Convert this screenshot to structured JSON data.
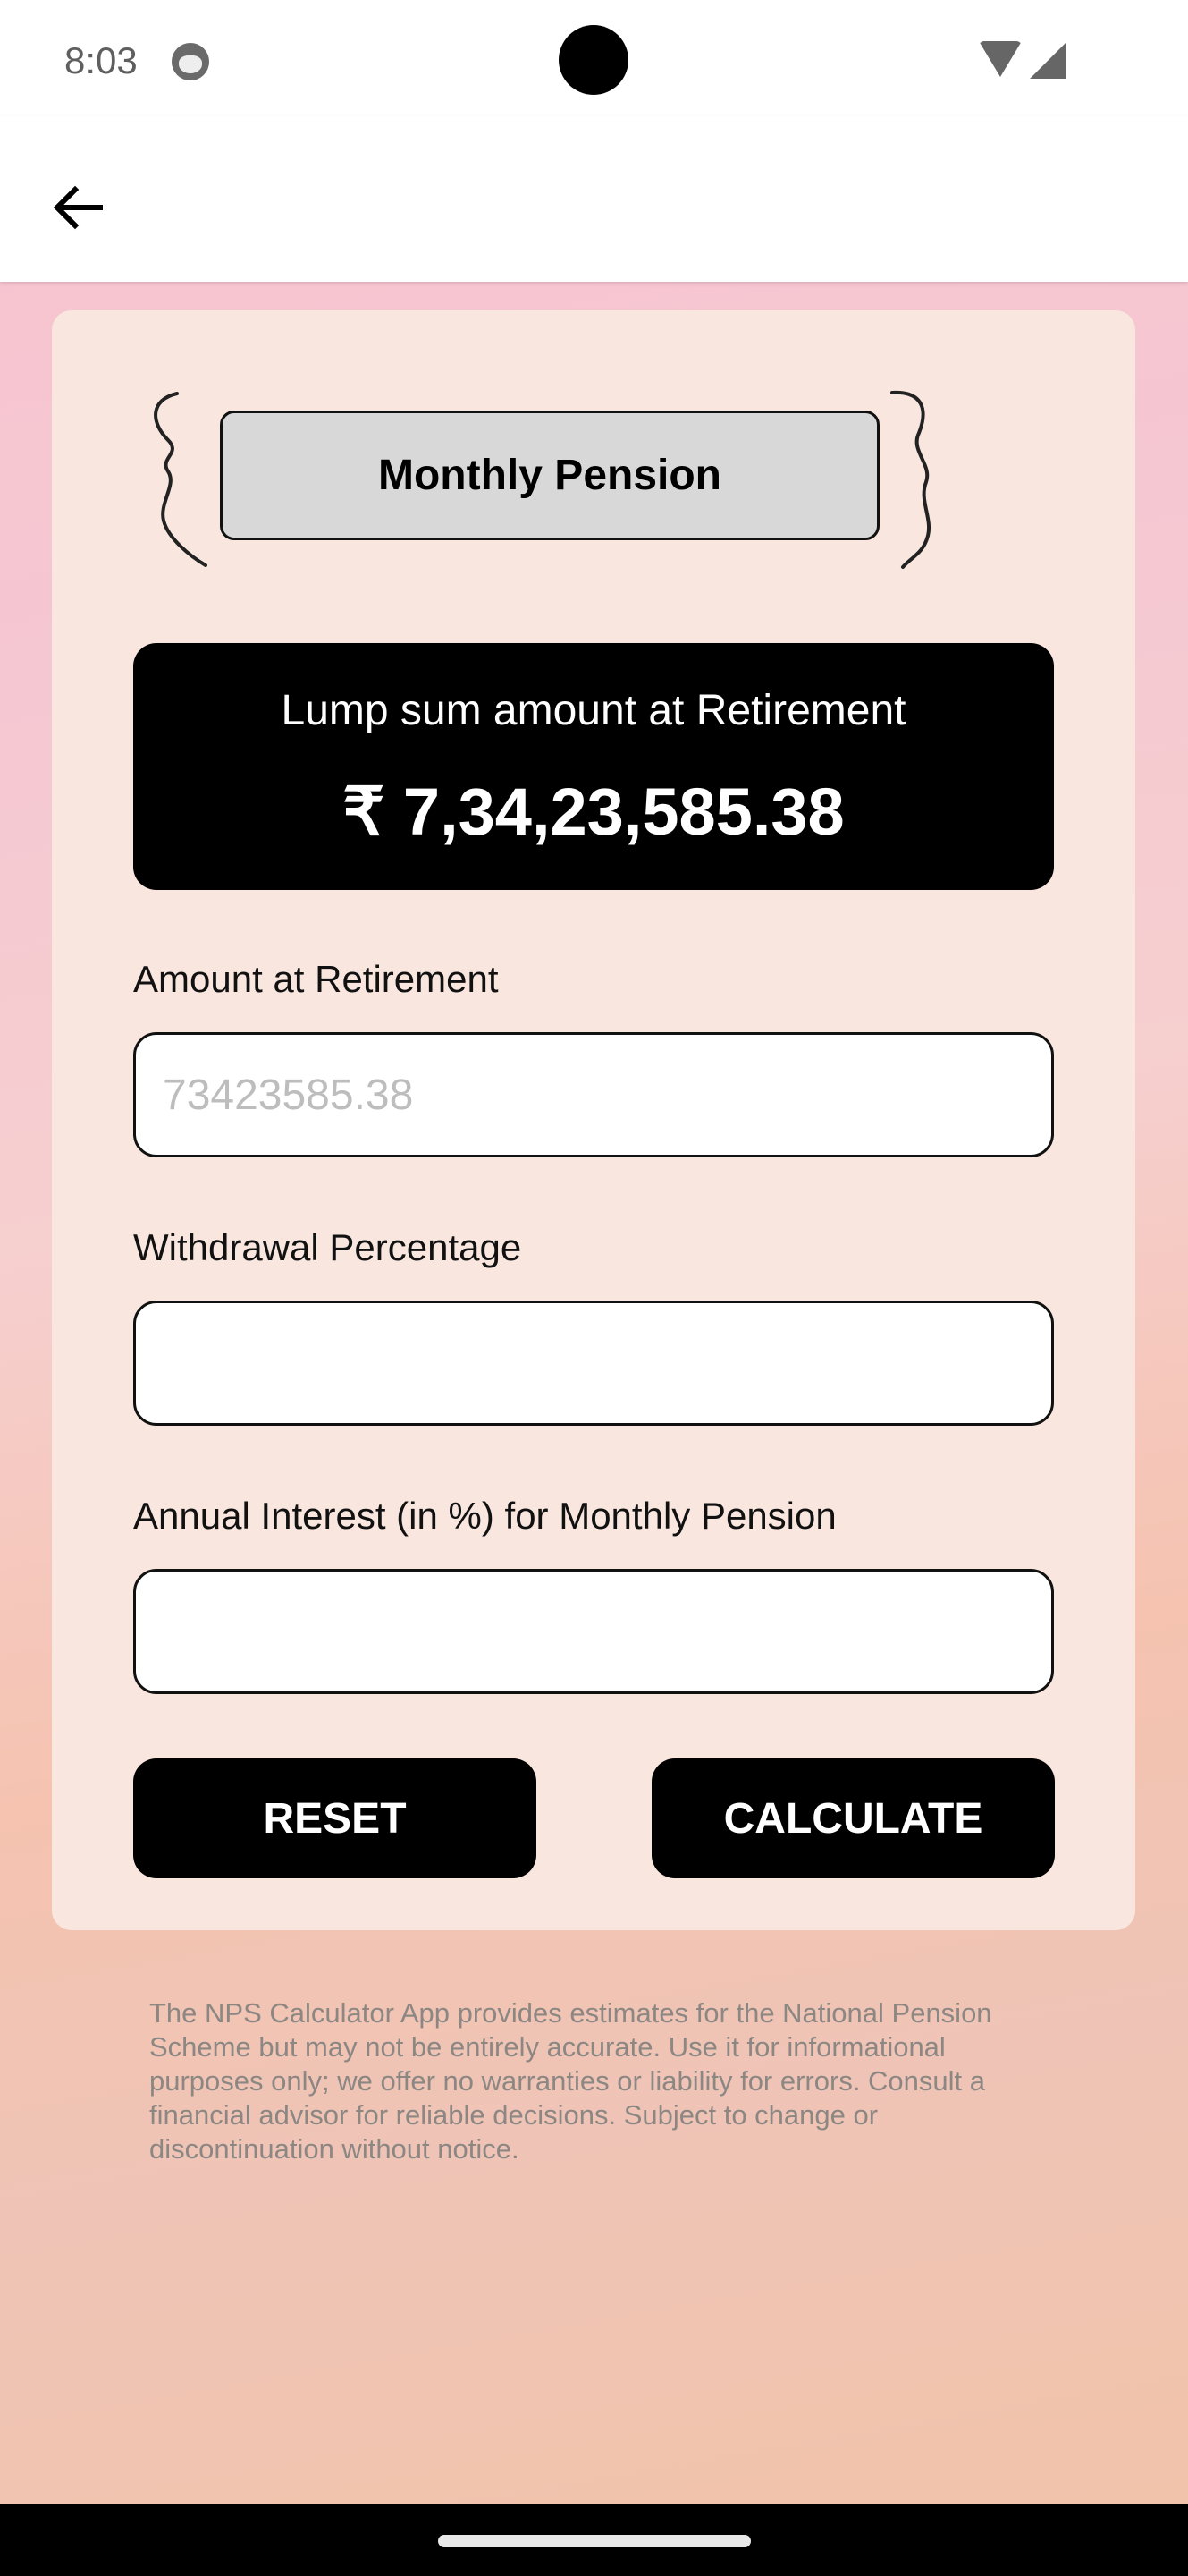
{
  "status_bar": {
    "time": "8:03",
    "icons": [
      "app-notification-icon",
      "wifi-icon",
      "cellular-signal-icon"
    ]
  },
  "app_bar": {
    "back_icon": "arrow-left-icon"
  },
  "card": {
    "title": "Monthly Pension",
    "result": {
      "label": "Lump sum amount at Retirement",
      "value": "₹ 7,34,23,585.38"
    },
    "fields": [
      {
        "label": "Amount at Retirement",
        "value": "",
        "placeholder": "73423585.38"
      },
      {
        "label": "Withdrawal Percentage",
        "value": "",
        "placeholder": ""
      },
      {
        "label": "Annual Interest (in %) for Monthly Pension",
        "value": "",
        "placeholder": ""
      }
    ],
    "buttons": {
      "reset": "RESET",
      "calculate": "CALCULATE"
    }
  },
  "disclaimer": "The NPS Calculator App provides estimates for the National Pension Scheme but may not be entirely accurate. Use it for informational purposes only; we offer no warranties or liability for errors. Consult a financial advisor for reliable decisions. Subject to change or discontinuation without notice.",
  "colors": {
    "card_background": "#f9e6de",
    "title_box": "#d8d8d8",
    "result_card": "#000000",
    "button": "#000000",
    "disclaimer_text": "#8c8783"
  }
}
